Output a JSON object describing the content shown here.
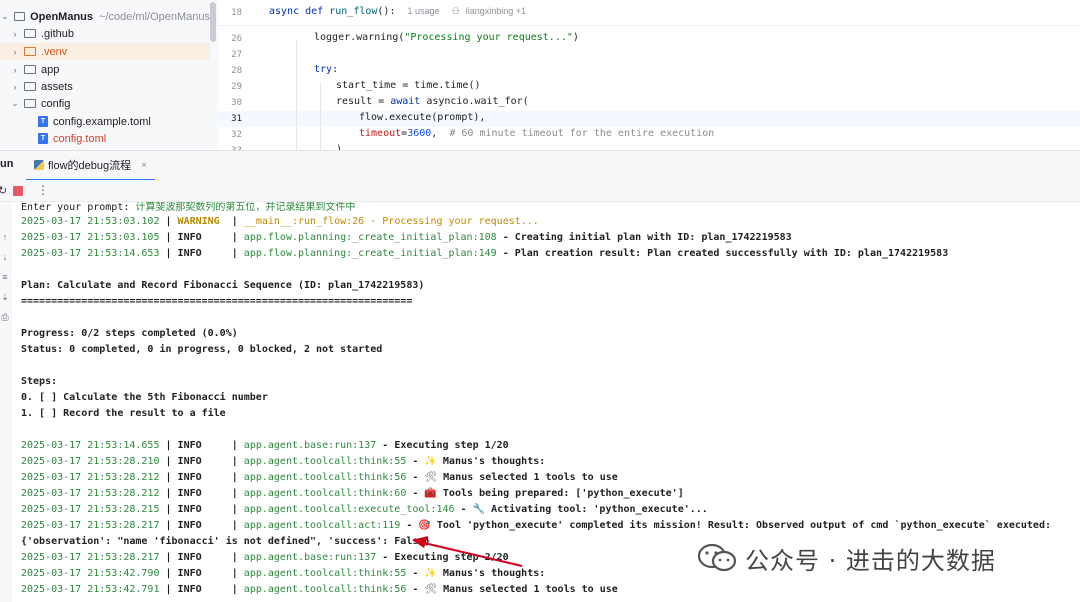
{
  "project_tree": {
    "root": {
      "name": "OpenManus",
      "path": "~/code/ml/OpenManus"
    },
    "items": [
      {
        "label": ".github",
        "type": "folder",
        "expanded": false
      },
      {
        "label": ".venv",
        "type": "folder",
        "expanded": false,
        "excluded": true
      },
      {
        "label": "app",
        "type": "folder",
        "expanded": false
      },
      {
        "label": "assets",
        "type": "folder",
        "expanded": false
      },
      {
        "label": "config",
        "type": "folder",
        "expanded": true
      },
      {
        "label": "config.example.toml",
        "type": "file"
      },
      {
        "label": "config.toml",
        "type": "file",
        "modified": true
      }
    ]
  },
  "editor": {
    "sticky": {
      "line": "18",
      "code_kw1": "async",
      "code_kw2": "def",
      "func": "run_flow",
      "tail": "():",
      "usages": "1 usage",
      "author": "liangxinbing +1"
    },
    "lines": [
      {
        "num": "26",
        "text": "logger.warning(\"Processing your request...\")"
      },
      {
        "num": "27",
        "text": ""
      },
      {
        "num": "28",
        "text": "try:"
      },
      {
        "num": "29",
        "text": "start_time = time.time()"
      },
      {
        "num": "30",
        "text": "result = await asyncio.wait_for("
      },
      {
        "num": "31",
        "text": "flow.execute(prompt),"
      },
      {
        "num": "32",
        "text": "timeout=3600,  # 60 minute timeout for the entire execution"
      },
      {
        "num": "33",
        "text": ")"
      }
    ],
    "tokens": {
      "logger": "logger.warning(",
      "logger_str": "\"Processing your request...\"",
      "logger_end": ")",
      "try": "try",
      "try_end": ":",
      "start_time": "start_time = time.time()",
      "result_pre": "result = ",
      "await": "await",
      "result_post": " asyncio.wait_for(",
      "flow_exec": "flow.execute(prompt),",
      "timeout_key": "timeout",
      "timeout_eq": "=",
      "timeout_val": "3600",
      "timeout_comma": ",  ",
      "timeout_cmt": "# 60 minute timeout for the entire execution",
      "close_paren": ")"
    }
  },
  "run_panel": {
    "title": "un",
    "tab_label": "flow的debug流程",
    "close_glyph": "×"
  },
  "console": {
    "prompt_line": {
      "label": "Enter your prompt: ",
      "value": "计算斐波那契数列的第五位，并记录结果到文件中"
    },
    "log1": {
      "ts": "2025-03-17 21:53:03.102",
      "level": "WARNING",
      "module": "__main__:run_flow:26",
      "msg": "Processing your request..."
    },
    "log2": {
      "ts": "2025-03-17 21:53:03.105",
      "level": "INFO",
      "module": "app.flow.planning:_create_initial_plan:108",
      "msg": "Creating initial plan with ID: plan_1742219583"
    },
    "log3": {
      "ts": "2025-03-17 21:53:14.653",
      "level": "INFO",
      "module": "app.flow.planning:_create_initial_plan:149",
      "msg": "Plan creation result: Plan created successfully with ID: plan_1742219583"
    },
    "plan_title": "Plan: Calculate and Record Fibonacci Sequence (ID: plan_1742219583)",
    "separator": "=================================================================",
    "progress": "Progress: 0/2 steps completed (0.0%)",
    "status": "Status: 0 completed, 0 in progress, 0 blocked, 2 not started",
    "steps_title": "Steps:",
    "step0": "0. [ ] Calculate the 5th Fibonacci number",
    "step1": "1. [ ] Record the result to a file",
    "log4": {
      "ts": "2025-03-17 21:53:14.655",
      "level": "INFO",
      "module": "app.agent.base:run:137",
      "msg": "Executing step 1/20"
    },
    "log5": {
      "ts": "2025-03-17 21:53:28.210",
      "level": "INFO",
      "module": "app.agent.toolcall:think:55",
      "icon": "✨",
      "msg": "Manus's thoughts:"
    },
    "log6": {
      "ts": "2025-03-17 21:53:28.212",
      "level": "INFO",
      "module": "app.agent.toolcall:think:56",
      "icon": "🛠",
      "msg": "Manus selected 1 tools to use"
    },
    "log7": {
      "ts": "2025-03-17 21:53:28.212",
      "level": "INFO",
      "module": "app.agent.toolcall:think:60",
      "icon": "🧰",
      "msg": "Tools being prepared: ['python_execute']"
    },
    "log8": {
      "ts": "2025-03-17 21:53:28.215",
      "level": "INFO",
      "module": "app.agent.toolcall:execute_tool:146",
      "icon": "🔧",
      "msg": "Activating tool: 'python_execute'..."
    },
    "log9": {
      "ts": "2025-03-17 21:53:28.217",
      "level": "INFO",
      "module": "app.agent.toolcall:act:119",
      "icon": "🎯",
      "msg": "Tool 'python_execute' completed its mission! Result: Observed output of cmd `python_execute` executed:"
    },
    "observation": "{'observation': \"name 'fibonacci' is not defined\", 'success': False}",
    "log10": {
      "ts": "2025-03-17 21:53:28.217",
      "level": "INFO",
      "module": "app.agent.base:run:137",
      "msg": "Executing step 2/20"
    },
    "log11": {
      "ts": "2025-03-17 21:53:42.790",
      "level": "INFO",
      "module": "app.agent.toolcall:think:55",
      "icon": "✨",
      "msg": "Manus's thoughts:"
    },
    "log12": {
      "ts": "2025-03-17 21:53:42.791",
      "level": "INFO",
      "module": "app.agent.toolcall:think:56",
      "icon": "🛠",
      "msg": "Manus selected 1 tools to use"
    }
  },
  "watermark": {
    "text": "公众号 · 进击的大数据"
  },
  "colors": {
    "accent": "#3574f0",
    "log_green": "#2d8a3e",
    "warning": "#b88c00",
    "arrow_red": "#d0021b"
  }
}
